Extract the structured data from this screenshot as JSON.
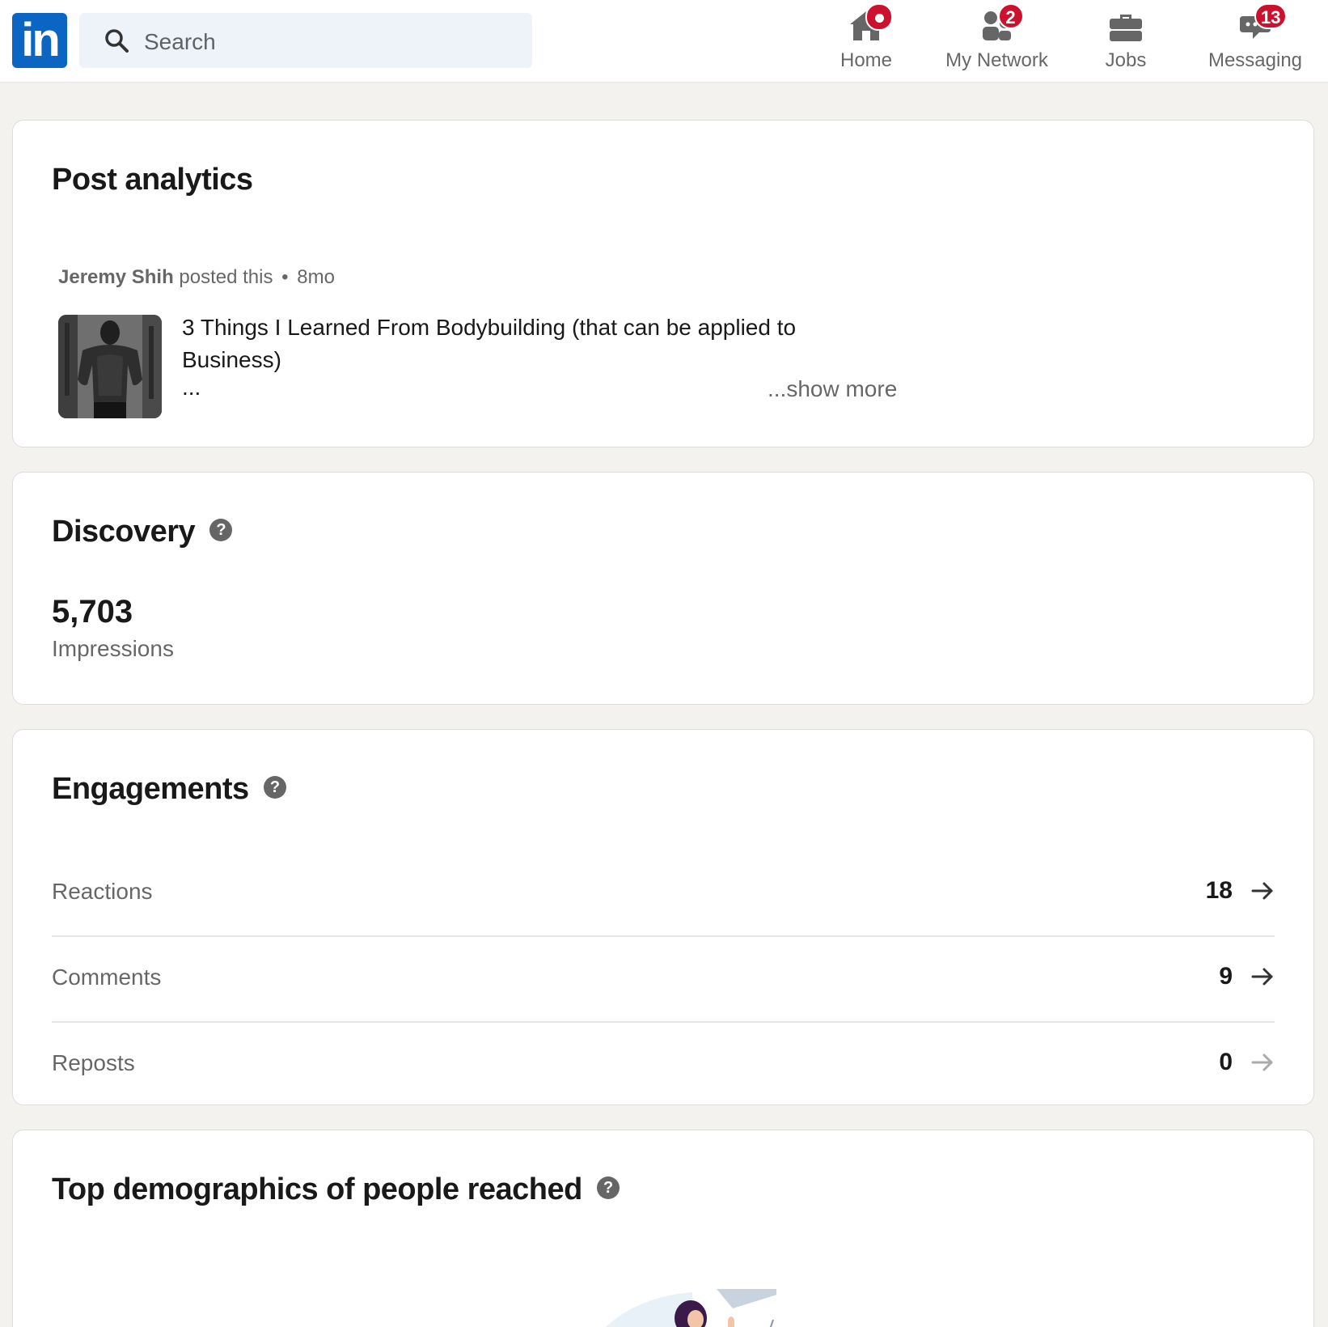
{
  "nav": {
    "logo": "in",
    "search_placeholder": "Search",
    "items": [
      {
        "label": "Home",
        "badge": ""
      },
      {
        "label": "My Network",
        "badge": "2"
      },
      {
        "label": "Jobs",
        "badge": ""
      },
      {
        "label": "Messaging",
        "badge": "13"
      }
    ]
  },
  "post": {
    "heading": "Post analytics",
    "author": "Jeremy Shih",
    "action": "posted this",
    "separator": "•",
    "age": "8mo",
    "title": "3 Things I Learned From Bodybuilding (that can be applied to Business)",
    "ellipsis": "...",
    "show_more": "...show more"
  },
  "discovery": {
    "heading": "Discovery",
    "help": "?",
    "impressions_value": "5,703",
    "impressions_label": "Impressions"
  },
  "engagements": {
    "heading": "Engagements",
    "help": "?",
    "rows": [
      {
        "label": "Reactions",
        "value": "18",
        "arrow": "→"
      },
      {
        "label": "Comments",
        "value": "9",
        "arrow": "→"
      },
      {
        "label": "Reposts",
        "value": "0",
        "arrow": "→"
      }
    ]
  },
  "demographics": {
    "heading": "Top demographics of people reached",
    "help": "?"
  },
  "colors": {
    "brand": "#0a66c2",
    "badge": "#cb112d",
    "page_bg": "#f3f2ef"
  }
}
